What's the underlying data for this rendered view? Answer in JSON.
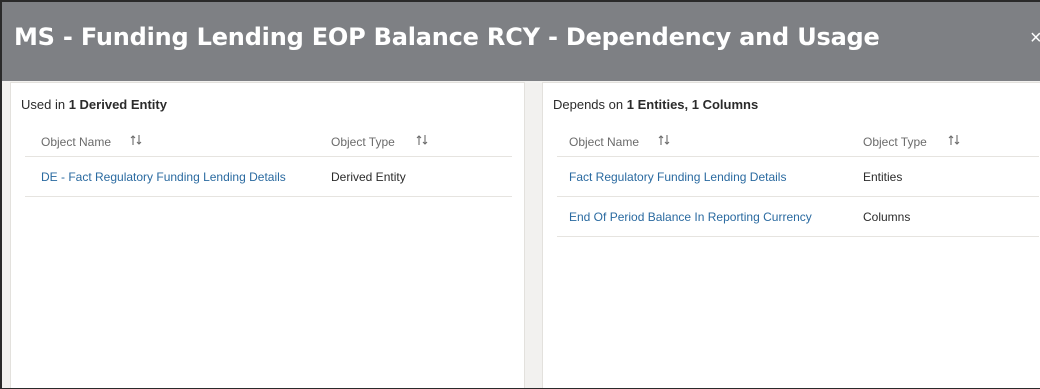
{
  "dialog": {
    "title": "MS - Funding Lending EOP Balance RCY - Dependency and Usage",
    "close_glyph": "×"
  },
  "used_in": {
    "prefix": "Used in ",
    "count_label": "1 Derived Entity",
    "columns": {
      "name": "Object Name",
      "type": "Object Type"
    },
    "rows": [
      {
        "name": "DE - Fact Regulatory Funding Lending Details",
        "type": "Derived Entity"
      }
    ]
  },
  "depends_on": {
    "prefix": "Depends on ",
    "count_label": "1 Entities, 1 Columns",
    "columns": {
      "name": "Object Name",
      "type": "Object Type"
    },
    "rows": [
      {
        "name": "Fact Regulatory Funding Lending Details",
        "type": "Entities"
      },
      {
        "name": "End Of Period Balance In Reporting Currency",
        "type": "Columns"
      }
    ]
  },
  "icons": {
    "sort": "sort-arrows-icon",
    "close": "close-icon"
  },
  "colors": {
    "header_bg": "#7e8084",
    "link": "#2a6aa0",
    "page_bg": "#f2f1ef"
  }
}
